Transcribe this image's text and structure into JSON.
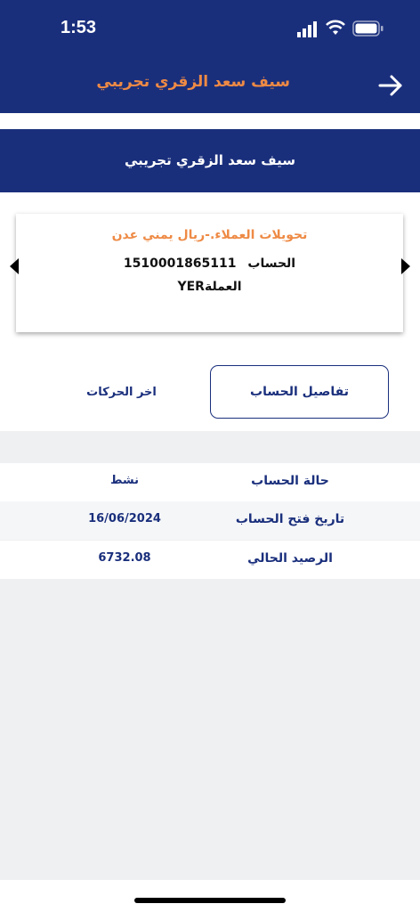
{
  "status_bar": {
    "time": "1:53",
    "icons": [
      "signal-icon",
      "wifi-icon",
      "battery-icon"
    ]
  },
  "header": {
    "title": "سيف سعد الزقري تجريبي",
    "back_icon": "arrow-right-icon"
  },
  "banner": {
    "name": "سيف سعد الزقري تجريبي"
  },
  "account_card": {
    "title": "تحويلات العملاء.-ريال يمني عدن",
    "account_label": "الحساب",
    "account_number": "1510001865111",
    "currency_label": "العملة",
    "currency_value": "YER",
    "nav_icons": [
      "chevron-left-icon",
      "chevron-right-icon"
    ]
  },
  "tabs": {
    "details": "تفاصيل الحساب",
    "transactions": "اخر الحركات"
  },
  "details": [
    {
      "label": "حالة الحساب",
      "value": "نشط"
    },
    {
      "label": "تاريخ فتح الحساب",
      "value": "16/06/2024"
    },
    {
      "label": "الرصيد الحالي",
      "value": "6732.08"
    }
  ],
  "colors": {
    "primary": "#1a2f7c",
    "accent": "#ee8a45",
    "background_grey": "#eff0f2",
    "row_alt": "#f5f6f8"
  }
}
